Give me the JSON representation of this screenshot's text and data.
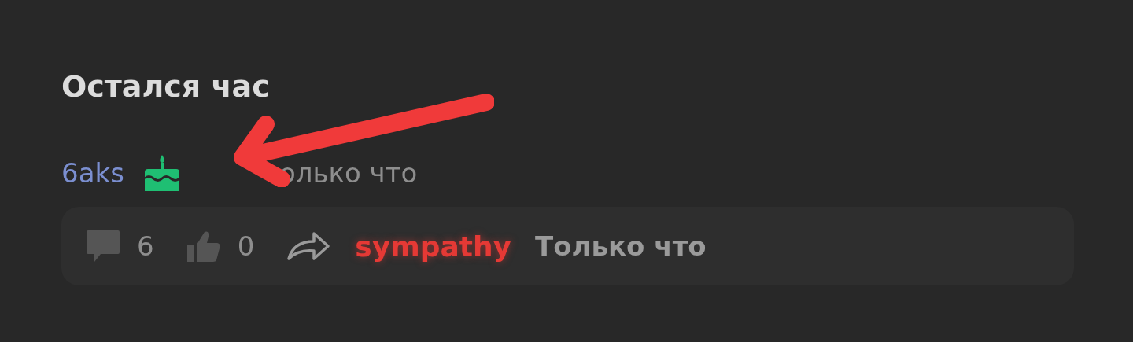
{
  "post": {
    "title": "Остался час",
    "author": "6aks",
    "time_visible": "олько что"
  },
  "footer": {
    "comments": "6",
    "likes": "0",
    "tag": "sympathy",
    "time": "Только что"
  }
}
